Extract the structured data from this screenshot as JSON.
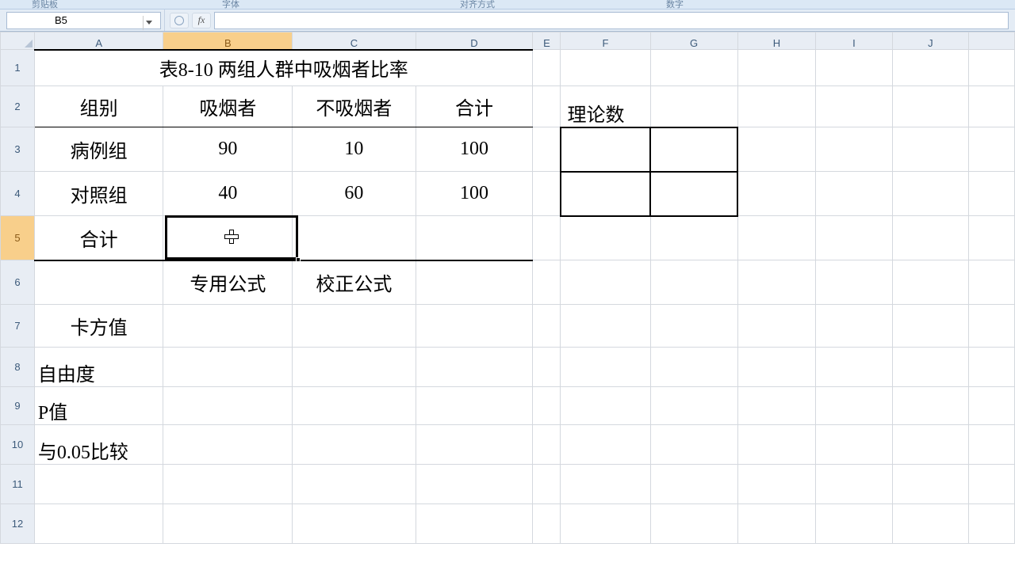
{
  "ribbon": {
    "group_clipboard": "剪贴板",
    "group_font": "字体",
    "group_align": "对齐方式",
    "group_number": "数字"
  },
  "namebox": {
    "value": "B5"
  },
  "fx_label": "fx",
  "columns": [
    "A",
    "B",
    "C",
    "D",
    "E",
    "F",
    "G",
    "H",
    "I",
    "J"
  ],
  "rows": [
    "1",
    "2",
    "3",
    "4",
    "5",
    "6",
    "7",
    "8",
    "9",
    "10",
    "11",
    "12"
  ],
  "active_cell": "B5",
  "cells": {
    "title": "表8-10 两组人群中吸烟者比率",
    "hdr_group": "组别",
    "hdr_smoker": "吸烟者",
    "hdr_nonsmoker": "不吸烟者",
    "hdr_total": "合计",
    "row_case": "病例组",
    "row_ctrl": "对照组",
    "row_total": "合计",
    "v_b3": "90",
    "v_c3": "10",
    "v_d3": "100",
    "v_b4": "40",
    "v_c4": "60",
    "v_d4": "100",
    "lbl_special": "专用公式",
    "lbl_correct": "校正公式",
    "lbl_chisq": "卡方值",
    "lbl_df": "自由度",
    "lbl_pval": "P值",
    "lbl_cmp": "与0.05比较",
    "lbl_theory": "理论数"
  },
  "chart_data": {
    "type": "table",
    "title": "表8-10 两组人群中吸烟者比率",
    "columns": [
      "组别",
      "吸烟者",
      "不吸烟者",
      "合计"
    ],
    "rows": [
      {
        "组别": "病例组",
        "吸烟者": 90,
        "不吸烟者": 10,
        "合计": 100
      },
      {
        "组别": "对照组",
        "吸烟者": 40,
        "不吸烟者": 60,
        "合计": 100
      },
      {
        "组别": "合计",
        "吸烟者": null,
        "不吸烟者": null,
        "合计": null
      }
    ],
    "aux": {
      "理论数": [
        [
          null,
          null
        ],
        [
          null,
          null
        ]
      ],
      "stats_labels": [
        "专用公式",
        "校正公式",
        "卡方值",
        "自由度",
        "P值",
        "与0.05比较"
      ]
    }
  }
}
